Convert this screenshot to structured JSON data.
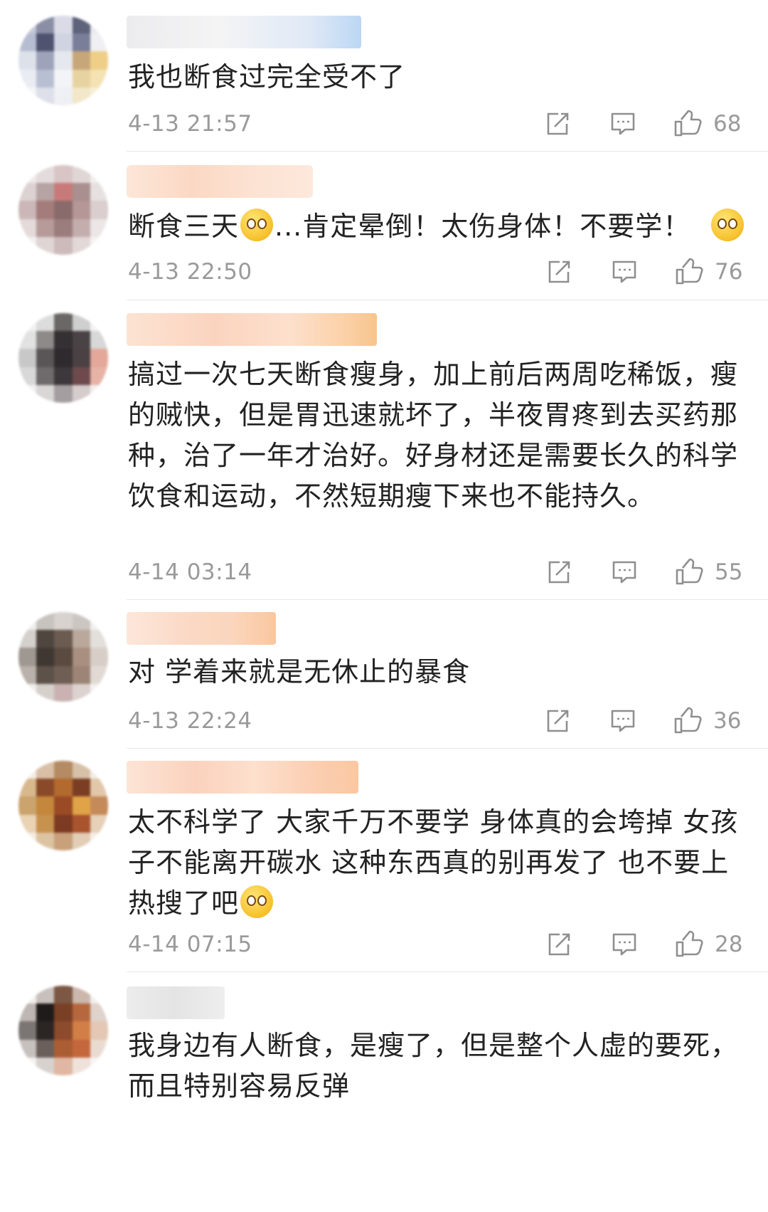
{
  "comments": [
    {
      "text": "我也断食过完全受不了",
      "time": "4-13 21:57",
      "likes": "68",
      "emoji_icons": []
    },
    {
      "text_before_emoji": "断食三天",
      "text_after_emoji": "...肯定晕倒！太伤身体！不要学！",
      "time": "4-13 22:50",
      "likes": "76",
      "emoji_icons": [
        "astonished-face-icon",
        "smirking-face-icon"
      ]
    },
    {
      "text": "搞过一次七天断食瘦身，加上前后两周吃稀饭，瘦的贼快，但是胃迅速就坏了，半夜胃疼到去买药那种，治了一年才治好。好身材还是需要长久的科学饮食和运动，不然短期瘦下来也不能持久。",
      "time": "4-14 03:14",
      "likes": "55",
      "emoji_icons": []
    },
    {
      "text": "对 学着来就是无休止的暴食",
      "time": "4-13 22:24",
      "likes": "36",
      "emoji_icons": []
    },
    {
      "text": "太不科学了 大家千万不要学 身体真的会垮掉 女孩子不能离开碳水 这种东西真的别再发了 也不要上热搜了吧",
      "time": "4-14 07:15",
      "likes": "28",
      "emoji_icons": [
        "eye-roll-face-icon"
      ]
    },
    {
      "text": "我身边有人断食，是瘦了，但是整个人虚的要死，而且特别容易反弹",
      "emoji_icons": []
    }
  ],
  "icons": {
    "share": "share-icon",
    "reply": "comment-icon",
    "like": "thumbs-up-icon"
  },
  "colors": {
    "text": "#222222",
    "meta": "#9a9a9a",
    "divider": "#e6e6e6",
    "emoji": "#f6c02a"
  }
}
